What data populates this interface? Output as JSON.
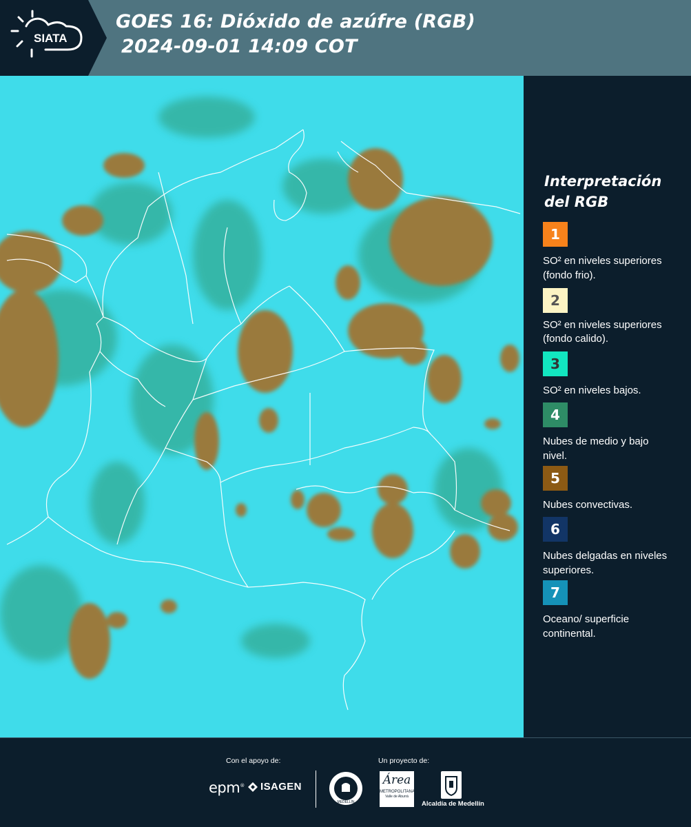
{
  "header": {
    "logo_text": "SIATA",
    "title_line1": "GOES 16: Dióxido de azúfre (RGB)",
    "title_line2": "2024-09-01 14:09 COT",
    "background_color": "#4f7480",
    "logo_tab_color": "#0c1e2c"
  },
  "map": {
    "background_color": "#3fdcea",
    "cloud_colors": {
      "convective": "#9a7a3c",
      "mid_low": "#2f8c6a",
      "border": "#ffffff"
    }
  },
  "legend": {
    "title_line1": "Interpretación",
    "title_line2": "del RGB",
    "items": [
      {
        "number": "1",
        "color": "#f7821b",
        "text_color": "#ffffff",
        "label": "SO² en niveles superiores (fondo frio)."
      },
      {
        "number": "2",
        "color": "#fcf4c4",
        "text_color": "#555555",
        "label": "SO² en niveles superiores (fondo calido)."
      },
      {
        "number": "3",
        "color": "#12e6c0",
        "text_color": "#333333",
        "label": "SO² en niveles bajos."
      },
      {
        "number": "4",
        "color": "#2e8c66",
        "text_color": "#ffffff",
        "label": "Nubes de medio y bajo nivel."
      },
      {
        "number": "5",
        "color": "#8c5a14",
        "text_color": "#ffffff",
        "label": "Nubes convectivas."
      },
      {
        "number": "6",
        "color": "#123566",
        "text_color": "#ffffff",
        "label": "Nubes delgadas en niveles superiores."
      },
      {
        "number": "7",
        "color": "#1592b8",
        "text_color": "#ffffff",
        "label": "Oceano/ superficie continental."
      }
    ]
  },
  "footer": {
    "support_label": "Con el apoyo de:",
    "project_label": "Un proyecto de:",
    "epm": "epm",
    "isagen": "ISAGEN",
    "area_name": "Área",
    "area_sub": "METROPOLITANA",
    "area_sub2": "Valle de Aburrá",
    "alcaldia": "Alcaldía de Medellín",
    "seal_text": "MEDELLÍN"
  }
}
